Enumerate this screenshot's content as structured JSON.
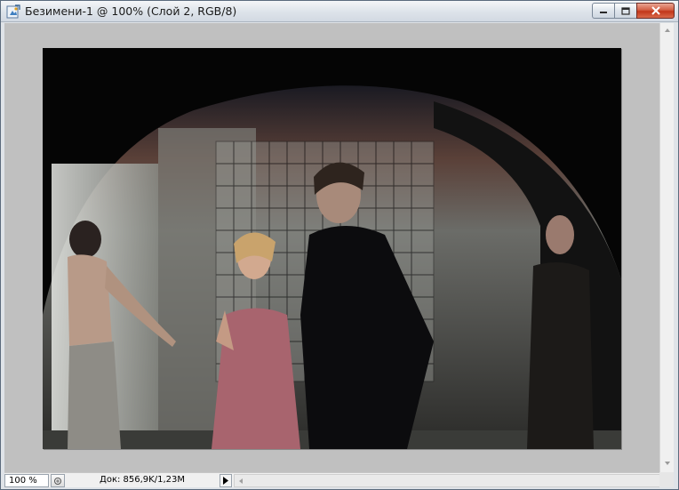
{
  "window": {
    "title": "Безимени-1 @ 100% (Слой 2, RGB/8)"
  },
  "canvas": {
    "background": "#c0c0c0",
    "image_description_icon": "photo-layer"
  },
  "statusbar": {
    "zoom": "100 %",
    "doc_info": "Док: 856,9K/1,23M"
  },
  "colors": {
    "close_button": "#c2361a",
    "title_bg": "#dde3ea"
  }
}
